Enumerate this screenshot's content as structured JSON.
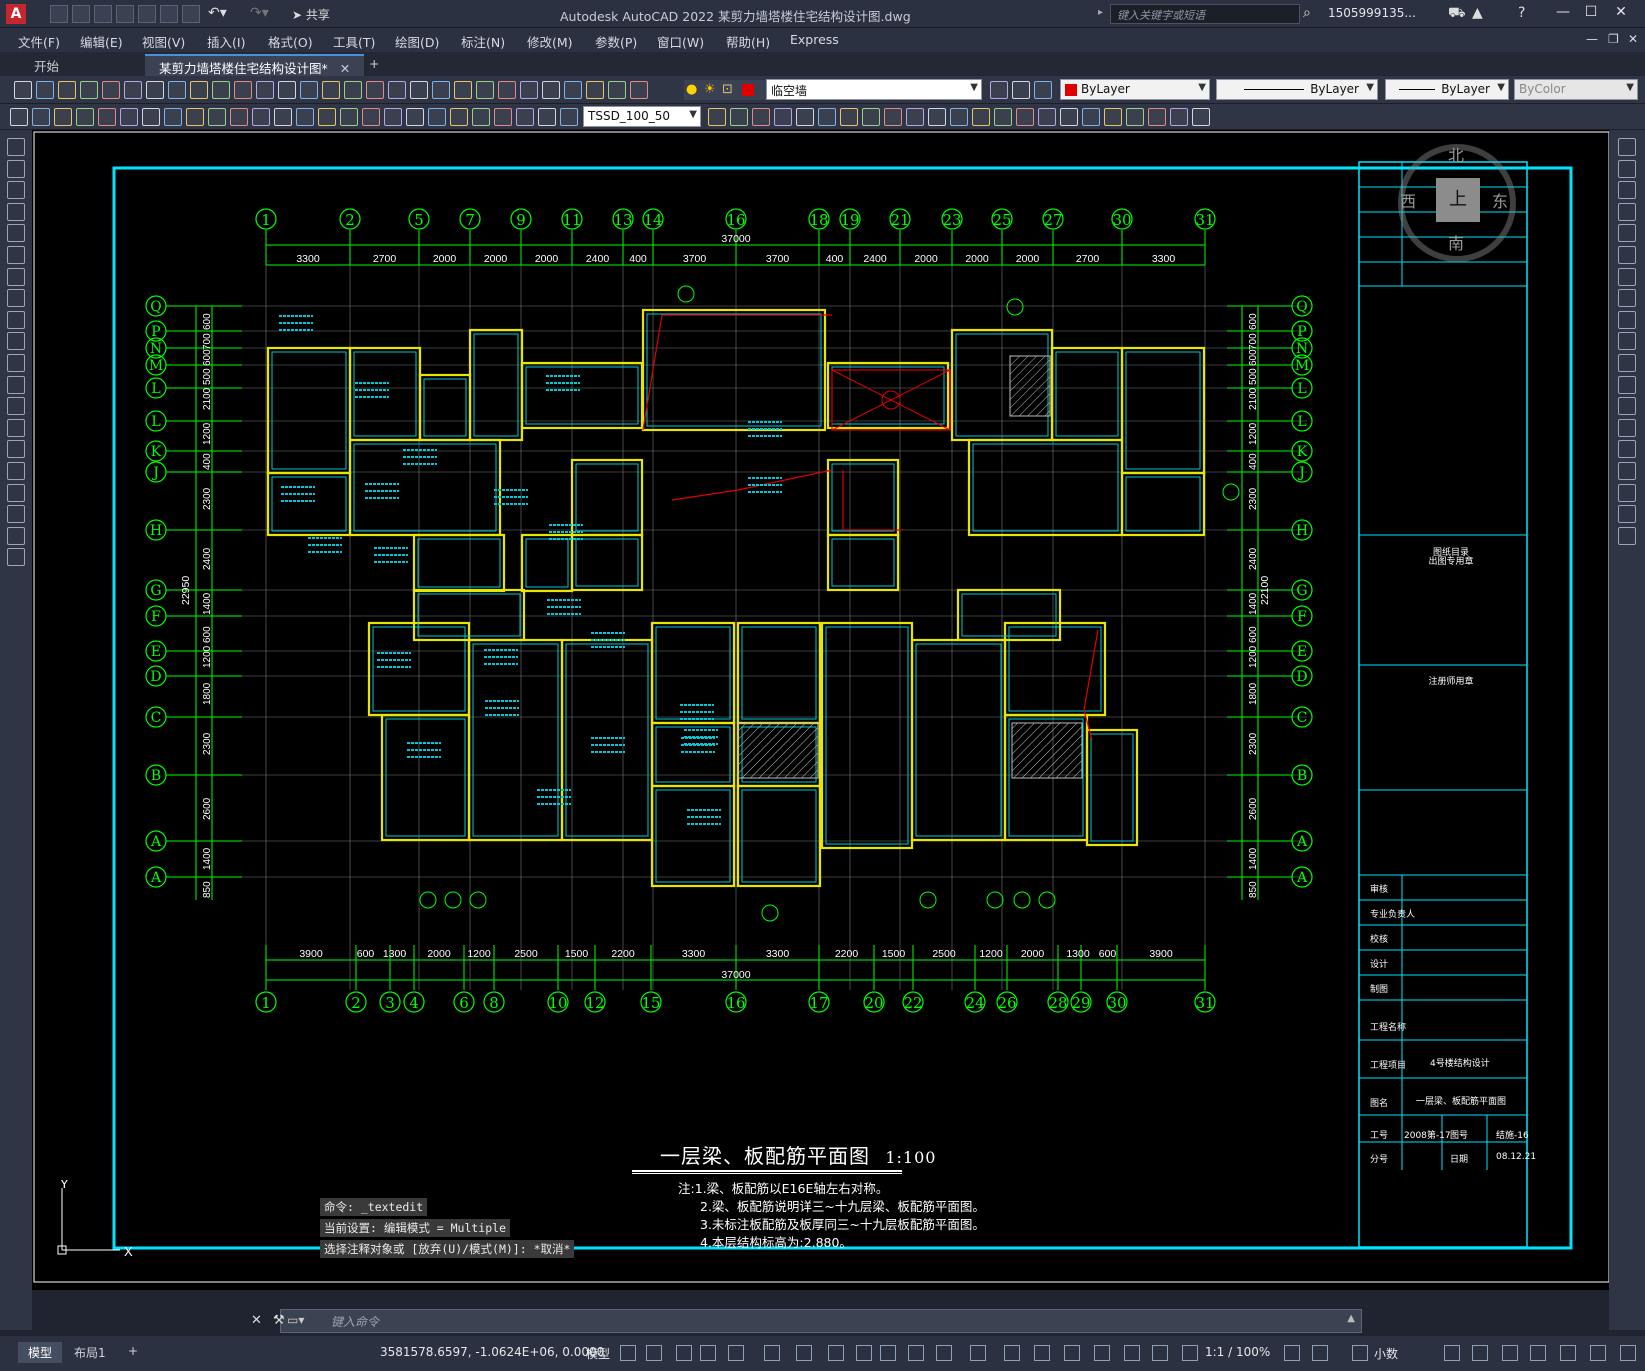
{
  "titlebar": {
    "app_title": "Autodesk AutoCAD 2022    某剪力墙塔楼住宅结构设计图.dwg",
    "share_label": "共享",
    "search_placeholder": "键入关键字或短语",
    "user": "1505999135..."
  },
  "menu": [
    "文件(F)",
    "编辑(E)",
    "视图(V)",
    "插入(I)",
    "格式(O)",
    "工具(T)",
    "绘图(D)",
    "标注(N)",
    "修改(M)",
    "参数(P)",
    "窗口(W)",
    "帮助(H)",
    "Express"
  ],
  "tabs": {
    "start": "开始",
    "document": "某剪力墙塔楼住宅结构设计图*",
    "add": "+"
  },
  "toolbar": {
    "layer": "临空墙",
    "color": "ByLayer",
    "linetype": "ByLayer",
    "lineweight": "ByLayer",
    "plotstyle": "ByColor",
    "dimstyle": "TSSD_100_50"
  },
  "viewcube": {
    "north": "北",
    "south": "南",
    "east": "东",
    "west": "西",
    "face": "上"
  },
  "drawing": {
    "title": "一层梁、板配筋平面图",
    "scale": "1:100",
    "notes": [
      "注:1.梁、板配筋以E16E轴左右对称。",
      "2.梁、板配筋说明详三~十九层梁、板配筋平面图。",
      "3.未标注板配筋及板厚同三~十九层板配筋平面图。",
      "4.本层结构标高为:2.880。"
    ],
    "axis_top": [
      "1",
      "2",
      "5",
      "7",
      "9",
      "11",
      "13",
      "14",
      "16",
      "18",
      "19",
      "21",
      "23",
      "25",
      "27",
      "30",
      "31"
    ],
    "axis_bottom": [
      "1",
      "2",
      "3",
      "4",
      "6",
      "8",
      "10",
      "12",
      "15",
      "16",
      "17",
      "20",
      "22",
      "24",
      "26",
      "28",
      "29",
      "30",
      "31"
    ],
    "axis_rows": [
      "Q",
      "P",
      "N",
      "M",
      "L",
      "L",
      "K",
      "J",
      "H",
      "G",
      "F",
      "E",
      "D",
      "C",
      "B",
      "A"
    ],
    "dims_top": [
      "3300",
      "2700",
      "2000",
      "2000",
      "2000",
      "2400",
      "400",
      "3700",
      "3700",
      "400",
      "2400",
      "2000",
      "2000",
      "2000",
      "2700",
      "3300"
    ],
    "dims_bottom": [
      "3900",
      "600",
      "1300",
      "2000",
      "1200",
      "2500",
      "1500",
      "2200",
      "3300",
      "3300",
      "2200",
      "1500",
      "2500",
      "1200",
      "2000",
      "1300",
      "600",
      "3900"
    ],
    "total_dim": "37000",
    "left_total": "22950",
    "right_total": "22100",
    "left_dims": [
      "600",
      "700",
      "600",
      "500",
      "2100",
      "1200",
      "400",
      "2300",
      "2400",
      "1400",
      "600",
      "1200",
      "1800",
      "2300",
      "2600",
      "1400",
      "850"
    ]
  },
  "titleblock": {
    "rows": [
      "审核",
      "专业负责人",
      "校核",
      "设计",
      "制图"
    ],
    "project_label": "工程名称",
    "item_label": "工程项目",
    "item_value": "4号楼结构设计",
    "drawing_label": "图名",
    "drawing_value": "一层梁、板配筋平面图",
    "job_label": "工号",
    "job_value": "2008第-17",
    "sheet_label": "图号",
    "sheet_value": "结施-16",
    "part_label": "分号",
    "date_label": "日期",
    "date_value": "08.12.21",
    "section_print": "出图专用章",
    "section_reg": "注册师用章",
    "section_catalog": "图纸目录"
  },
  "command": {
    "history": [
      "命令: _textedit",
      "当前设置: 编辑模式 = Multiple",
      "选择注释对象或 [放弃(U)/模式(M)]: *取消*"
    ],
    "placeholder": "键入命令"
  },
  "status": {
    "tab_model": "模型",
    "tab_layout1": "布局1",
    "coords": "3581578.6597, -1.0624E+06, 0.0000",
    "mode": "模型",
    "scale": "1:1 / 100%",
    "units": "小数"
  },
  "colors": {
    "accent": "#4a90d9",
    "frame": "#00e5ff",
    "grid": "#00ff00",
    "wall": "#e6e600",
    "beam": "#00c8d8"
  }
}
